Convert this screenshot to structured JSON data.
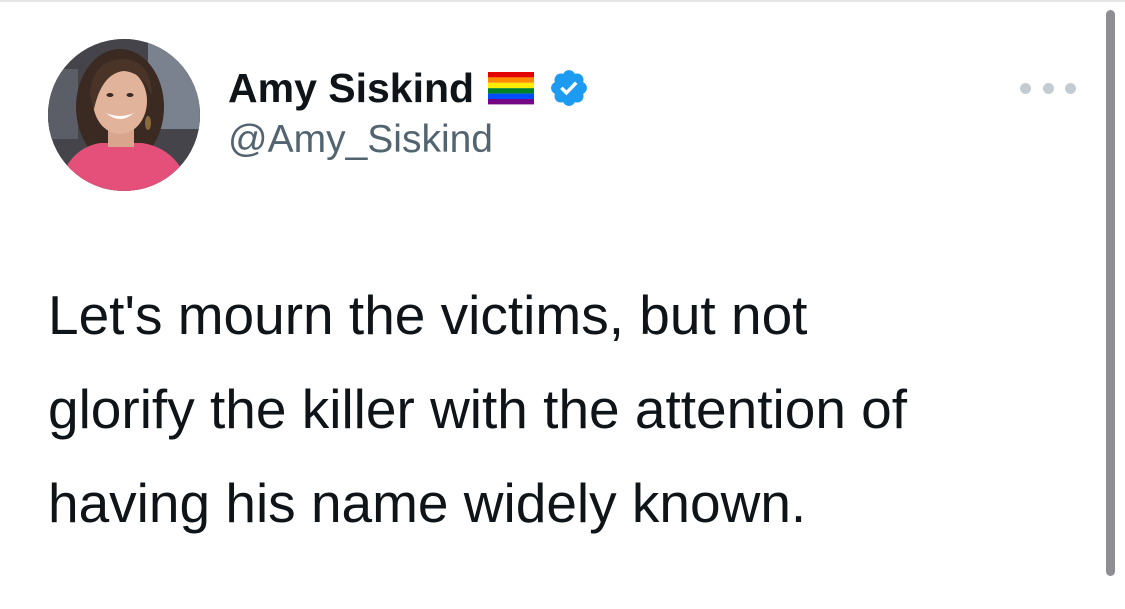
{
  "tweet": {
    "author": {
      "display_name": "Amy Siskind",
      "handle": "@Amy_Siskind",
      "flag_icon": "rainbow-flag-icon",
      "verified_icon": "verified-badge-icon",
      "verified_color": "#1d9bf0"
    },
    "text": "Let's mourn the victims, but not\nglorify the killer with the attention of\nhaving his name widely known.",
    "more_icon": "more-options-icon"
  }
}
